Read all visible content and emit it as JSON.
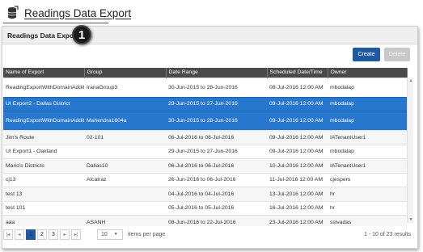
{
  "header": {
    "title": "Readings Data Export",
    "icon": "database-export-icon"
  },
  "panel": {
    "title": "Readings Data Export",
    "callout_number": "1"
  },
  "toolbar": {
    "create_label": "Create",
    "delete_label": "Delete"
  },
  "table": {
    "columns": [
      "Name of Export",
      "Group",
      "Date Range",
      "Scheduled Date/Time",
      "Owner"
    ],
    "rows": [
      {
        "name": "ReadingExportWithDomainAddition1",
        "group": "IranaGroup3",
        "range": "30-Jun-2015 to 28-Jun-2016",
        "sched": "08-Jul-2016 12:00 AM",
        "owner": "mbodalap"
      },
      {
        "name": "UI Export2 - Dallas District",
        "group": "",
        "range": "29-Jun-2015 to 27-Jun-2016",
        "sched": "09-Jul-2016 12:00 AM",
        "owner": "mbodalap"
      },
      {
        "name": "ReadingExportWithDomainAddition",
        "group": "Mahendra1604a",
        "range": "30-Jun-2015 to 28-Jun-2016",
        "sched": "09-Jul-2016 12:00 AM",
        "owner": "mbodalap"
      },
      {
        "name": "Jim's Route",
        "group": "02-101",
        "range": "06-Jul-2016 to 06-Jul-2016",
        "sched": "09-Jul-2016 12:00 AM",
        "owner": "IATenantUser1"
      },
      {
        "name": "UI Export1 - Oakland",
        "group": "",
        "range": "29-Jun-2015 to 27-Jun-2016",
        "sched": "09-Jul-2016 12:00 AM",
        "owner": "mbodalap"
      },
      {
        "name": "Mario's Districts",
        "group": "Dallas10",
        "range": "06-Jul-2016 to 06-Jul-2016",
        "sched": "10-Jul-2016 12:00 AM",
        "owner": "IATenantUser1"
      },
      {
        "name": "cj13",
        "group": "Alcatraz",
        "range": "26-Jun-2016 to 06-Jul-2016",
        "sched": "11-Jul-2016 12:00 AM",
        "owner": "cjespers"
      },
      {
        "name": "test 13",
        "group": "",
        "range": "04-Jul-2016 to 04-Jul-2016",
        "sched": "13-Jul-2016 12:00 AM",
        "owner": "hr"
      },
      {
        "name": "test 101",
        "group": "",
        "range": "05-Jul-2016 to 05-Jul-2016",
        "sched": "16-Jul-2016 12:00 AM",
        "owner": "hr"
      },
      {
        "name": "aaa",
        "group": "ASANH",
        "range": "08-Jun-2016 to 22-Jul-2016",
        "sched": "23-Jul-2016 12:00 AM",
        "owner": "ssivadas"
      }
    ]
  },
  "pager": {
    "pages": [
      "1",
      "2",
      "3"
    ],
    "current_page": "1",
    "first": "|◂",
    "prev": "◂",
    "next": "▸",
    "last": "▸|",
    "page_size": "10",
    "page_size_label": "items per page",
    "results": "1 - 10 of 23 results"
  },
  "colors": {
    "selected_row": "#2877cf",
    "header_bg": "#4a4a4a",
    "primary_button": "#1f5aa0"
  }
}
